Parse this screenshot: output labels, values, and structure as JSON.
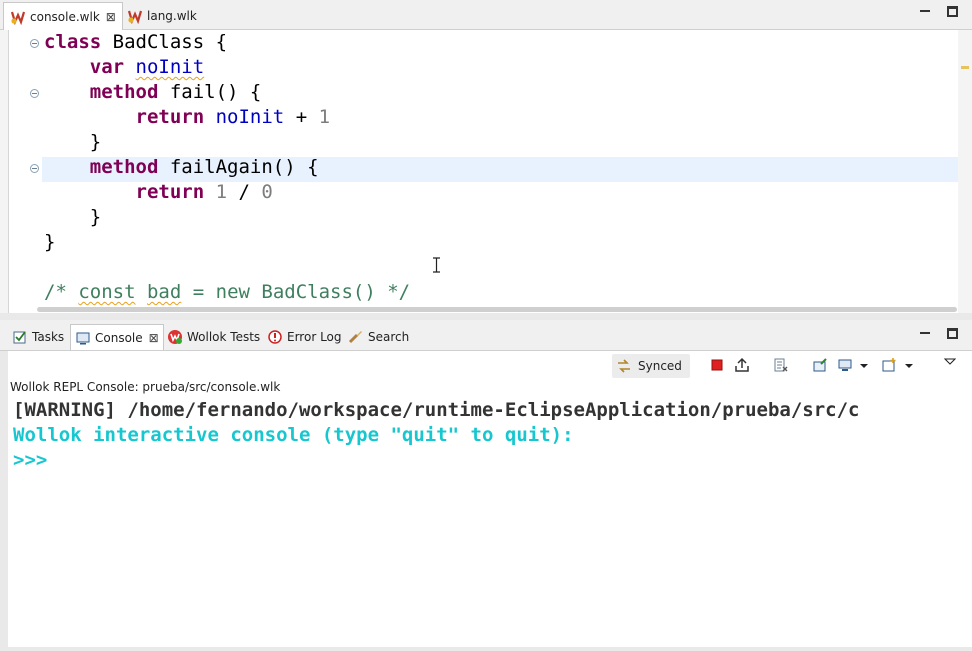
{
  "editor": {
    "tabs": [
      {
        "label": "console.wlk",
        "active": true,
        "close": "⊠"
      },
      {
        "label": "lang.wlk",
        "active": false
      }
    ],
    "code": [
      {
        "indent": "",
        "parts": [
          {
            "t": "class",
            "c": "kw"
          },
          {
            "t": " BadClass {",
            "c": ""
          }
        ]
      },
      {
        "indent": "    ",
        "parts": [
          {
            "t": "var",
            "c": "kw"
          },
          {
            "t": " ",
            "c": ""
          },
          {
            "t": "noInit",
            "c": "fld squig"
          }
        ]
      },
      {
        "indent": "    ",
        "parts": [
          {
            "t": "method",
            "c": "kw"
          },
          {
            "t": " fail() {",
            "c": ""
          }
        ]
      },
      {
        "indent": "        ",
        "parts": [
          {
            "t": "return",
            "c": "kw"
          },
          {
            "t": " ",
            "c": ""
          },
          {
            "t": "noInit",
            "c": "fld"
          },
          {
            "t": " + ",
            "c": ""
          },
          {
            "t": "1",
            "c": "num"
          }
        ]
      },
      {
        "indent": "    ",
        "parts": [
          {
            "t": "}",
            "c": ""
          }
        ]
      },
      {
        "indent": "    ",
        "parts": [
          {
            "t": "method",
            "c": "kw"
          },
          {
            "t": " failAgain() {",
            "c": ""
          }
        ]
      },
      {
        "indent": "        ",
        "parts": [
          {
            "t": "return",
            "c": "kw"
          },
          {
            "t": " ",
            "c": ""
          },
          {
            "t": "1",
            "c": "num"
          },
          {
            "t": " / ",
            "c": ""
          },
          {
            "t": "0",
            "c": "num"
          }
        ]
      },
      {
        "indent": "    ",
        "parts": [
          {
            "t": "}",
            "c": ""
          }
        ]
      },
      {
        "indent": "",
        "parts": [
          {
            "t": "}",
            "c": ""
          }
        ]
      },
      {
        "indent": "",
        "parts": []
      },
      {
        "indent": "",
        "parts": [
          {
            "t": "/* ",
            "c": "cmt"
          },
          {
            "t": "const",
            "c": "cmt squig"
          },
          {
            "t": " ",
            "c": "cmt"
          },
          {
            "t": "bad",
            "c": "cmt squig"
          },
          {
            "t": " = new BadClass() */",
            "c": "cmt"
          }
        ]
      }
    ]
  },
  "console": {
    "tabs": [
      {
        "label": "Tasks",
        "icon": "tasks-icon"
      },
      {
        "label": "Console",
        "icon": "console-icon",
        "active": true,
        "close": "⊠"
      },
      {
        "label": "Wollok Tests",
        "icon": "wollok-tests-icon"
      },
      {
        "label": "Error Log",
        "icon": "error-log-icon"
      },
      {
        "label": "Search",
        "icon": "search-icon"
      }
    ],
    "synced_label": "Synced",
    "title": "Wollok REPL Console: prueba/src/console.wlk",
    "lines": [
      {
        "text": "[WARNING] /home/fernando/workspace/runtime-EclipseApplication/prueba/src/c",
        "cls": "c-warn"
      },
      {
        "text": "Wollok interactive console (type \"quit\" to quit):",
        "cls": "c-cyan"
      },
      {
        "text": ">>>",
        "cls": "c-cyan"
      }
    ]
  },
  "colors": {
    "keyword": "#7f0055",
    "field": "#0000c0",
    "comment": "#3f7f5f",
    "console_prompt": "#17c7cf"
  }
}
